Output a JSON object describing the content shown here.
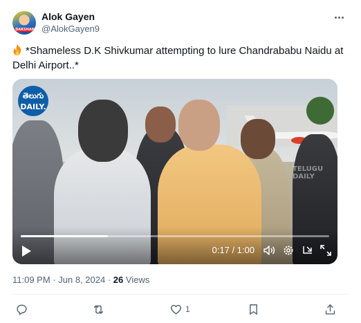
{
  "author": {
    "name": "Alok Gayen",
    "handle": "@AlokGayen9"
  },
  "tweet": {
    "emoji_icon": "fire-icon",
    "text": "*Shameless D.K Shivkumar attempting to lure Chandrababu Naidu at Delhi Airport..*"
  },
  "video": {
    "logo_line1": "తెలుగు",
    "logo_line2": "DAILY.",
    "watermark": "TELUGU DAILY",
    "current_time": "0:17",
    "duration": "1:00",
    "time_display": "0:17 / 1:00",
    "progress_fraction": 0.283
  },
  "meta": {
    "time": "11:09 PM",
    "date": "Jun 8, 2024",
    "views_count": "26",
    "views_label": "Views"
  },
  "actions": {
    "reply": {
      "icon": "reply-icon",
      "count": ""
    },
    "retweet": {
      "icon": "retweet-icon",
      "count": ""
    },
    "like": {
      "icon": "heart-icon",
      "count": "1"
    },
    "bookmark": {
      "icon": "bookmark-icon",
      "count": ""
    },
    "share": {
      "icon": "share-icon",
      "count": ""
    }
  },
  "colors": {
    "text": "#0f1419",
    "secondary": "#536471",
    "divider": "#eff3f4"
  }
}
